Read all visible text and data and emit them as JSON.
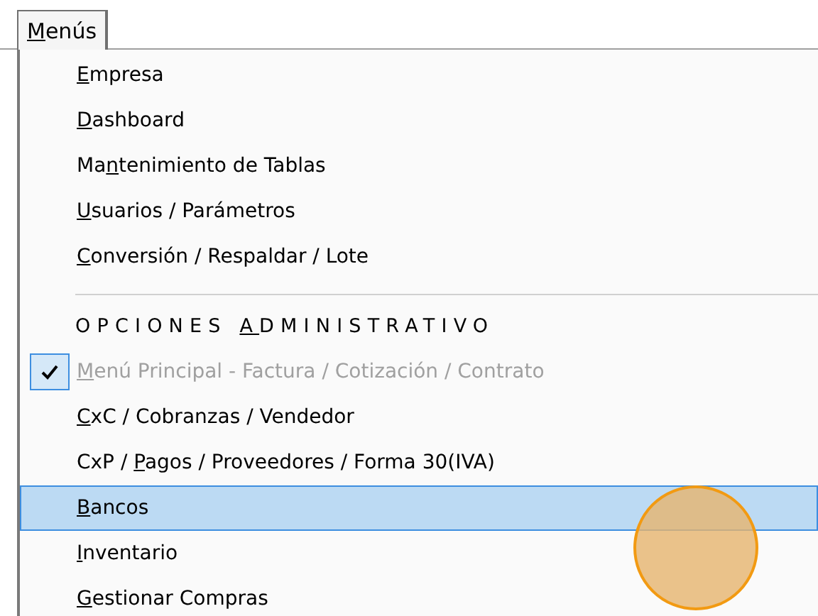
{
  "menu_tab": {
    "key": "M",
    "post": "enús",
    "selected": true
  },
  "items": [
    {
      "kind": "item",
      "key": "E",
      "post": "mpresa",
      "checked": false,
      "disabled": false,
      "selected": false
    },
    {
      "kind": "item",
      "key": "D",
      "post": "ashboard",
      "checked": false,
      "disabled": false,
      "selected": false
    },
    {
      "kind": "item",
      "pre": "Ma",
      "key": "n",
      "post": "tenimiento de Tablas",
      "checked": false,
      "disabled": false,
      "selected": false
    },
    {
      "kind": "item",
      "key": "U",
      "post": "suarios / Parámetros",
      "checked": false,
      "disabled": false,
      "selected": false
    },
    {
      "kind": "item",
      "key": "C",
      "post": "onversión / Respaldar / Lote",
      "checked": false,
      "disabled": false,
      "selected": false
    },
    {
      "kind": "separator"
    },
    {
      "kind": "header",
      "pre": "OPCIONES ",
      "key": "A",
      "post": "DMINISTRATIVO"
    },
    {
      "kind": "item",
      "key": "M",
      "post": "enú Principal - Factura / Cotización / Contrato",
      "checked": true,
      "disabled": true,
      "selected": false
    },
    {
      "kind": "item",
      "key": "C",
      "post": "xC / Cobranzas / Vendedor",
      "checked": false,
      "disabled": false,
      "selected": false
    },
    {
      "kind": "item",
      "pre": "CxP / ",
      "key": "P",
      "post": "agos / Proveedores / Forma 30(IVA)",
      "checked": false,
      "disabled": false,
      "selected": false
    },
    {
      "kind": "item",
      "key": "B",
      "post": "ancos",
      "checked": false,
      "disabled": false,
      "selected": true
    },
    {
      "kind": "item",
      "key": "I",
      "post": "nventario",
      "checked": false,
      "disabled": false,
      "selected": false
    },
    {
      "kind": "item",
      "key": "G",
      "post": "estionar Compras",
      "checked": false,
      "disabled": false,
      "selected": false
    }
  ]
}
